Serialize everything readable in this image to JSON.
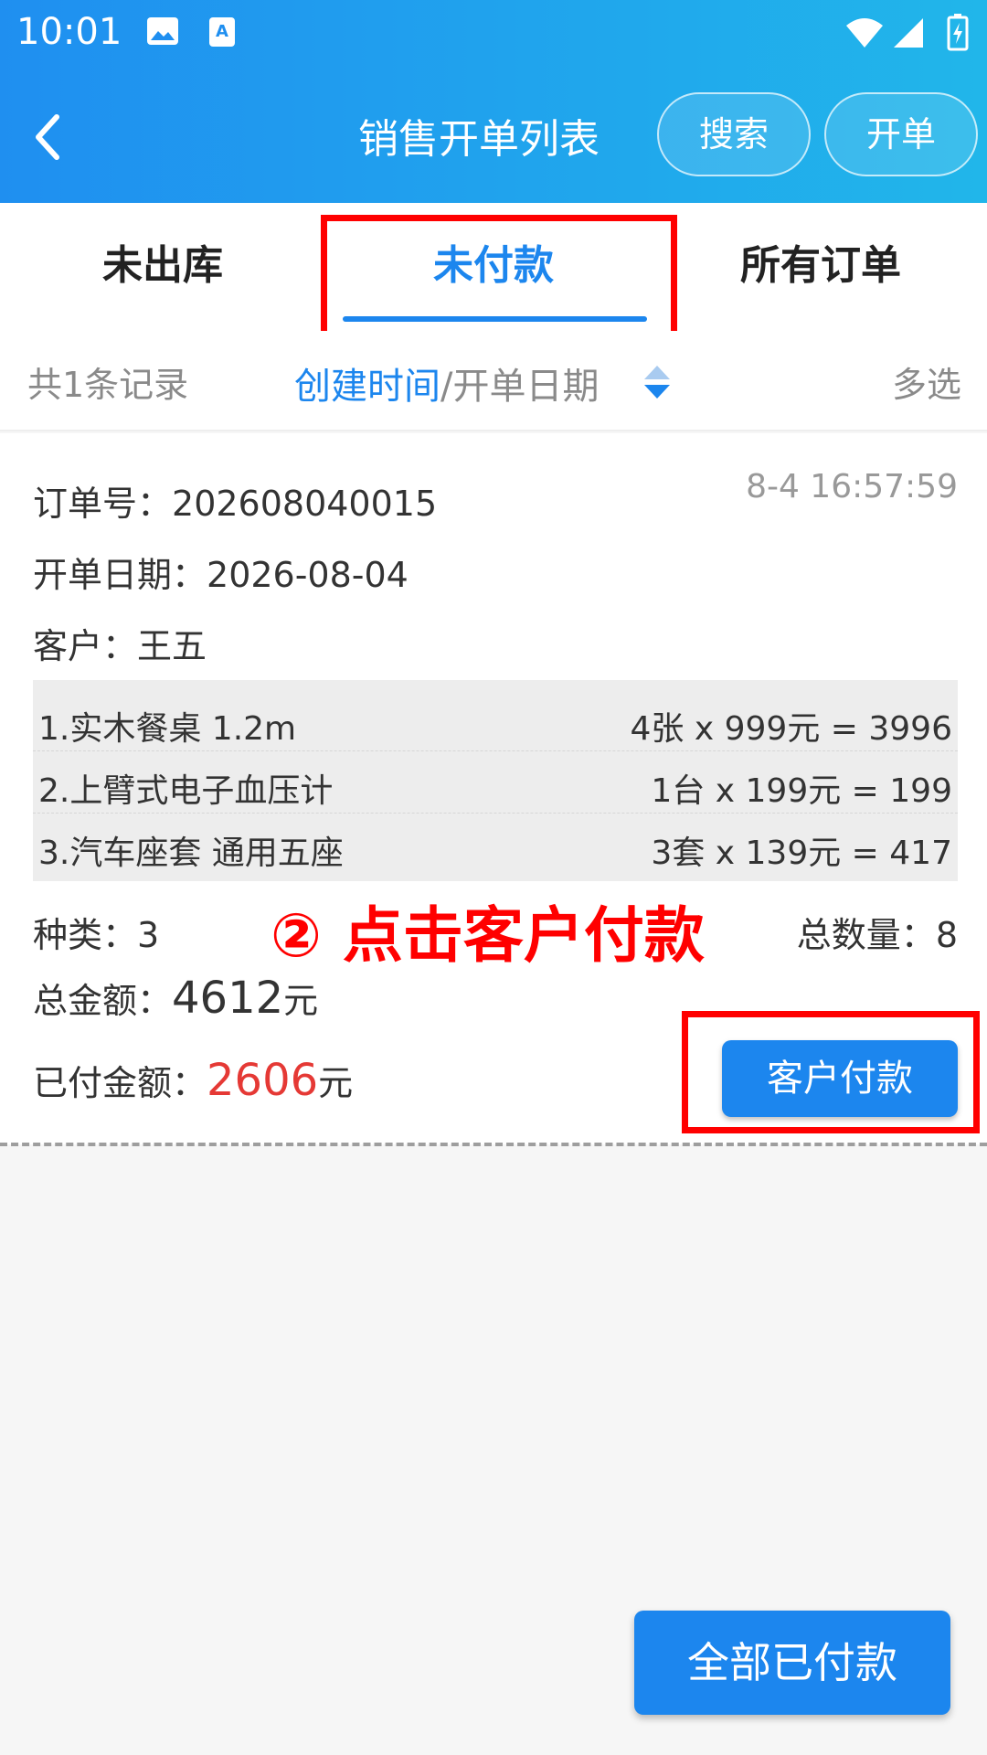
{
  "status_bar": {
    "time": "10:01"
  },
  "header": {
    "title": "销售开单列表",
    "search_label": "搜索",
    "open_label": "开单"
  },
  "tabs": [
    {
      "label": "未出库"
    },
    {
      "label": "未付款",
      "active": true
    },
    {
      "label": "所有订单"
    }
  ],
  "filter": {
    "count": "共1条记录",
    "sort_active": "创建时间",
    "sort_rest": "/开单日期",
    "multi": "多选"
  },
  "order": {
    "order_no_label": "订单号：",
    "order_no": "202608040015",
    "created_time": "8-4 16:57:59",
    "date_label": "开单日期：",
    "date": "2026-08-04",
    "customer_label": "客户：",
    "customer": "王五",
    "items": [
      {
        "name": "1.实木餐桌 1.2m",
        "calc": "4张 x 999元 = 3996"
      },
      {
        "name": "2.上臂式电子血压计",
        "calc": "1台 x 199元 = 199"
      },
      {
        "name": "3.汽车座套 通用五座",
        "calc": "3套 x 139元 = 417"
      }
    ],
    "kinds_label": "种类：",
    "kinds": "3",
    "qty_label": "总数量：",
    "qty": "8",
    "total_label": "总金额：",
    "total": "4612",
    "paid_label": "已付金额：",
    "paid": "2606",
    "yuan": "元",
    "pay_button": "客户付款"
  },
  "annotation": "② 点击客户付款",
  "bottom_button": "全部已付款",
  "colors": {
    "primary": "#1c86ee",
    "highlight": "#ff0000",
    "paid": "#e53935"
  }
}
